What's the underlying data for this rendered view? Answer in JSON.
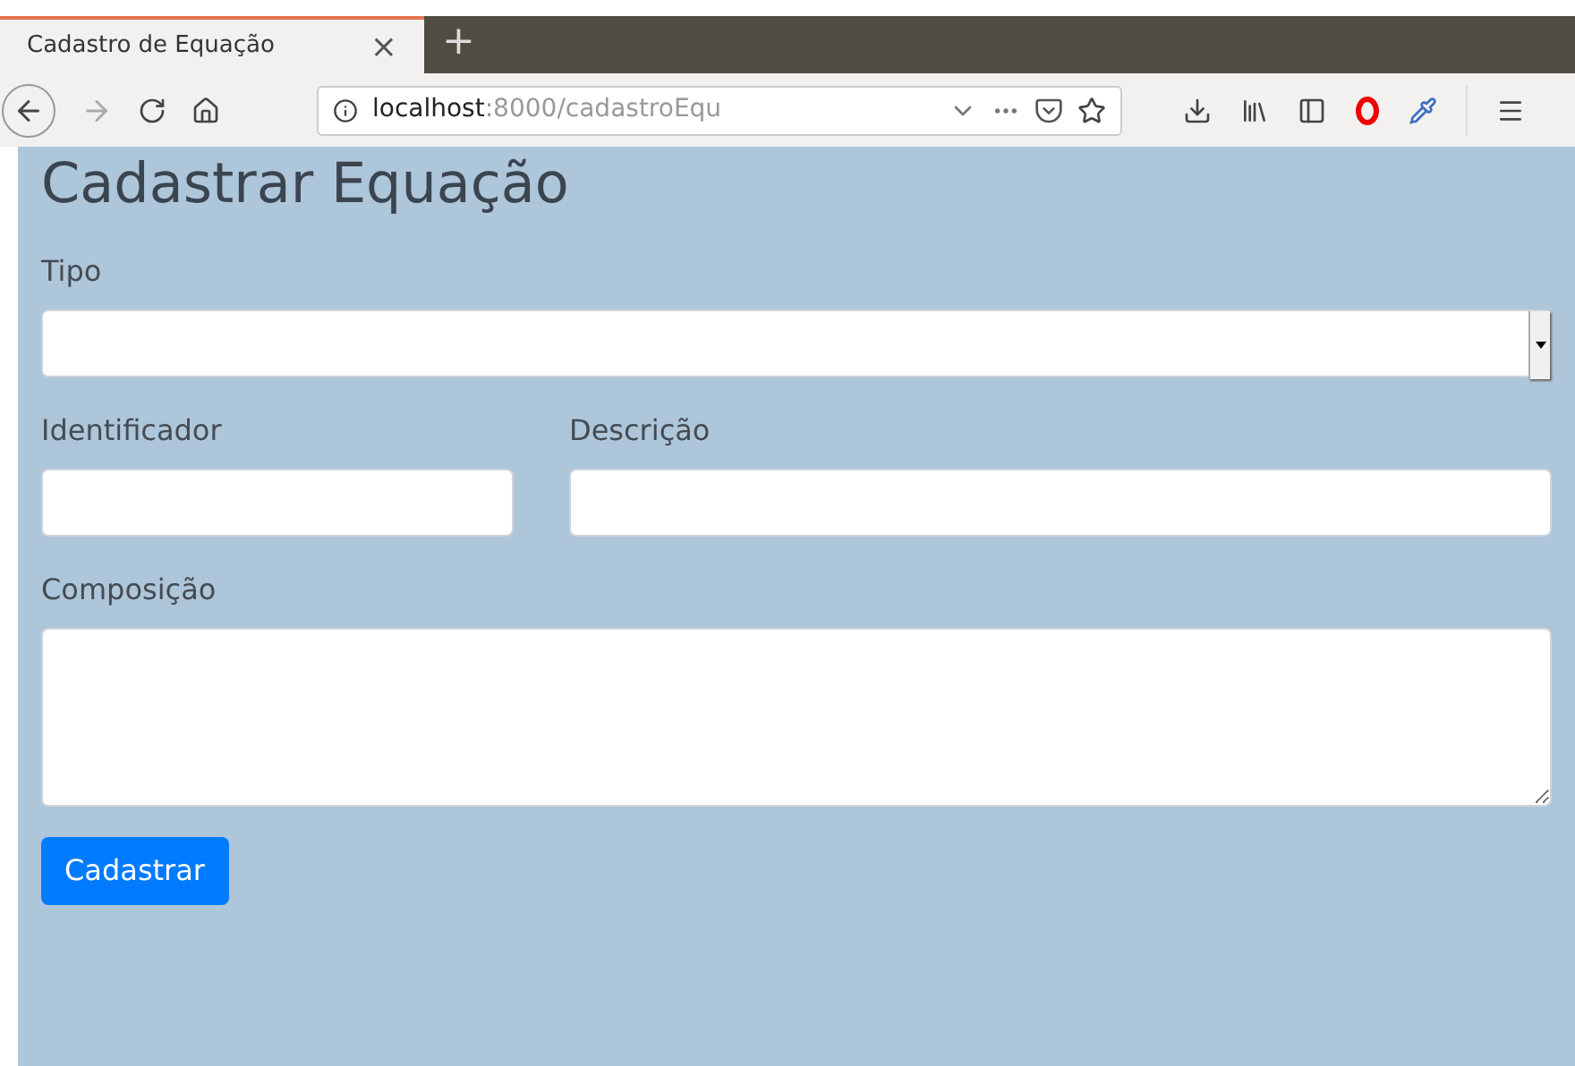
{
  "browser": {
    "tab_title": "Cadastro de Equação",
    "tab_close": "×",
    "new_tab": "+",
    "url_host": "localhost",
    "url_path": ":8000/cadastroEqu"
  },
  "page": {
    "heading": "Cadastrar Equação",
    "fields": [
      {
        "kind": "select",
        "label": "Tipo"
      },
      {
        "kind": "input",
        "label": "Identificador"
      },
      {
        "kind": "input",
        "label": "Descrição"
      },
      {
        "kind": "textarea",
        "label": "Composição"
      }
    ],
    "submit": "Cadastrar"
  }
}
